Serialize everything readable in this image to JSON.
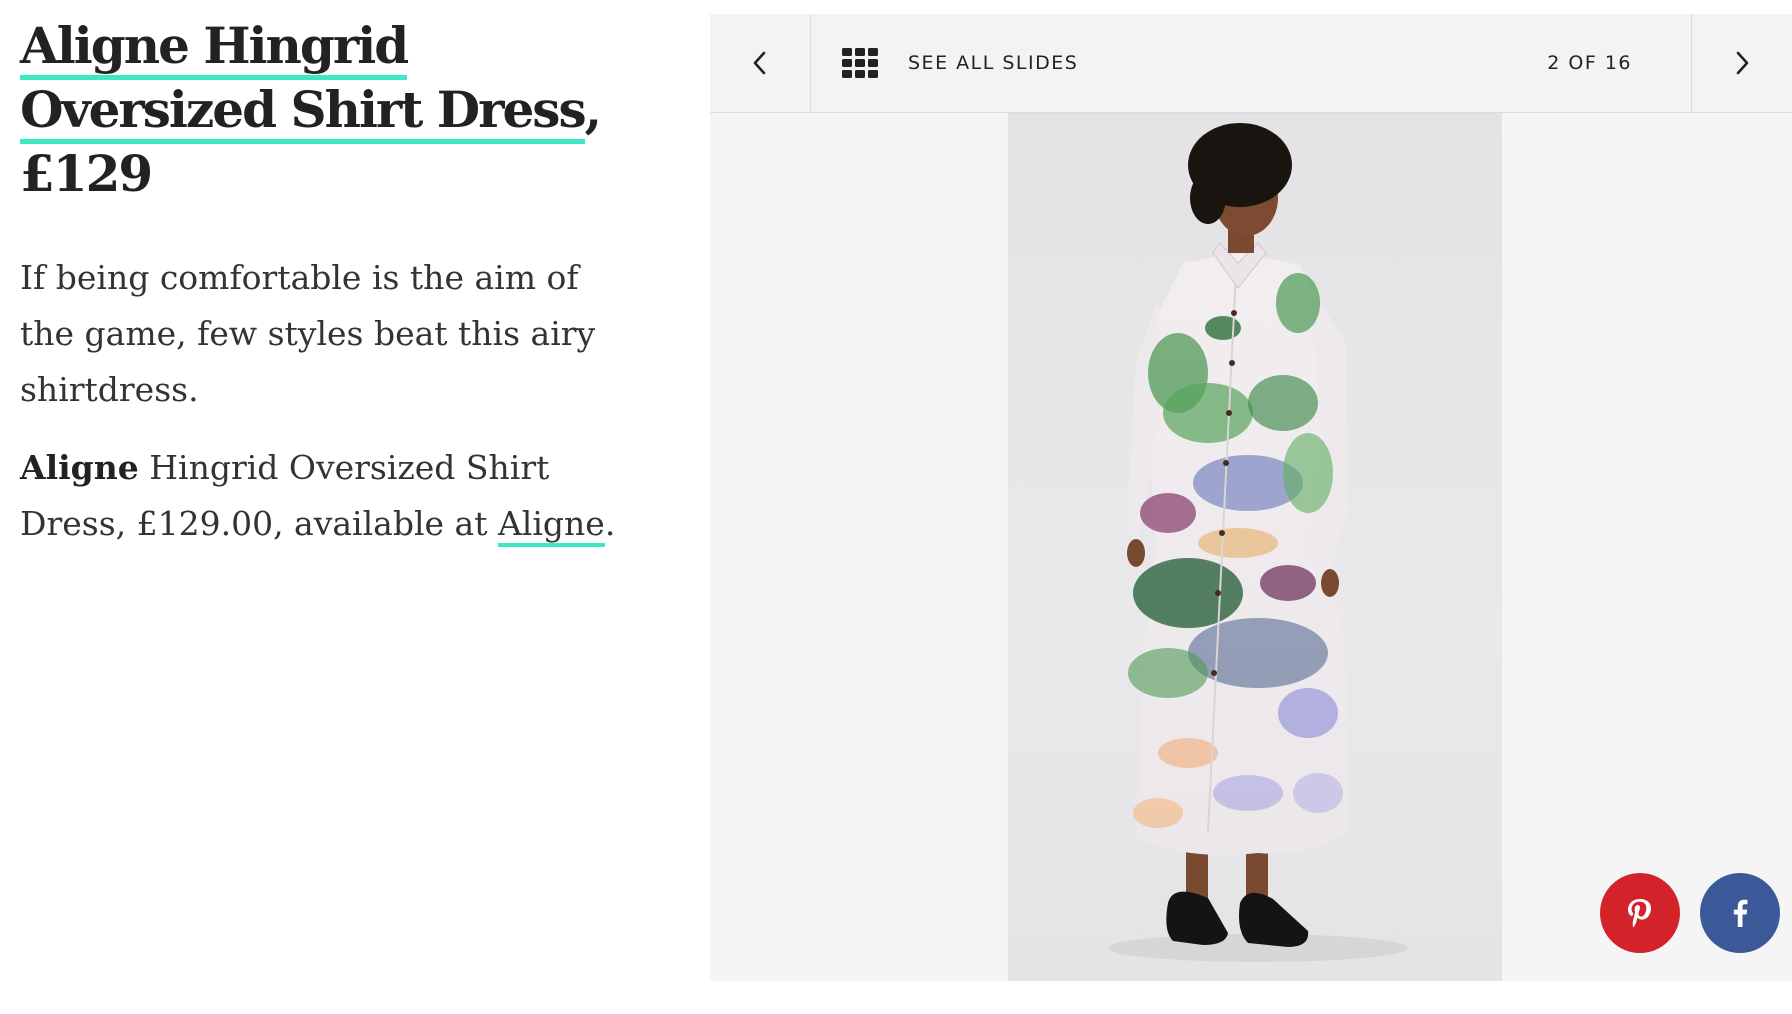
{
  "article": {
    "headline_link": "Aligne Hingrid Oversized Shirt Dress",
    "headline_price": ", £129",
    "description": "If being comfortable is the aim of the game, few styles beat this airy shirtdress.",
    "credit_brand": "Aligne",
    "credit_text": " Hingrid Oversized Shirt Dress, £129.00, available at ",
    "credit_link": "Aligne",
    "credit_end": "."
  },
  "slideshow": {
    "see_all_label": "SEE ALL SLIDES",
    "counter": "2 OF 16",
    "image_alt": "Model wearing the Aligne Hingrid watercolour-print oversized shirt dress with black sandals",
    "prev_icon": "chevron-left-icon",
    "next_icon": "chevron-right-icon",
    "grid_icon": "grid-icon"
  },
  "share": {
    "pinterest_icon": "pinterest-icon",
    "facebook_icon": "facebook-icon",
    "pinterest_color": "#d2232a",
    "facebook_color": "#3b5998"
  },
  "colors": {
    "link_underline": "#3de8c3",
    "slideshow_bg": "#f5f5f5"
  }
}
